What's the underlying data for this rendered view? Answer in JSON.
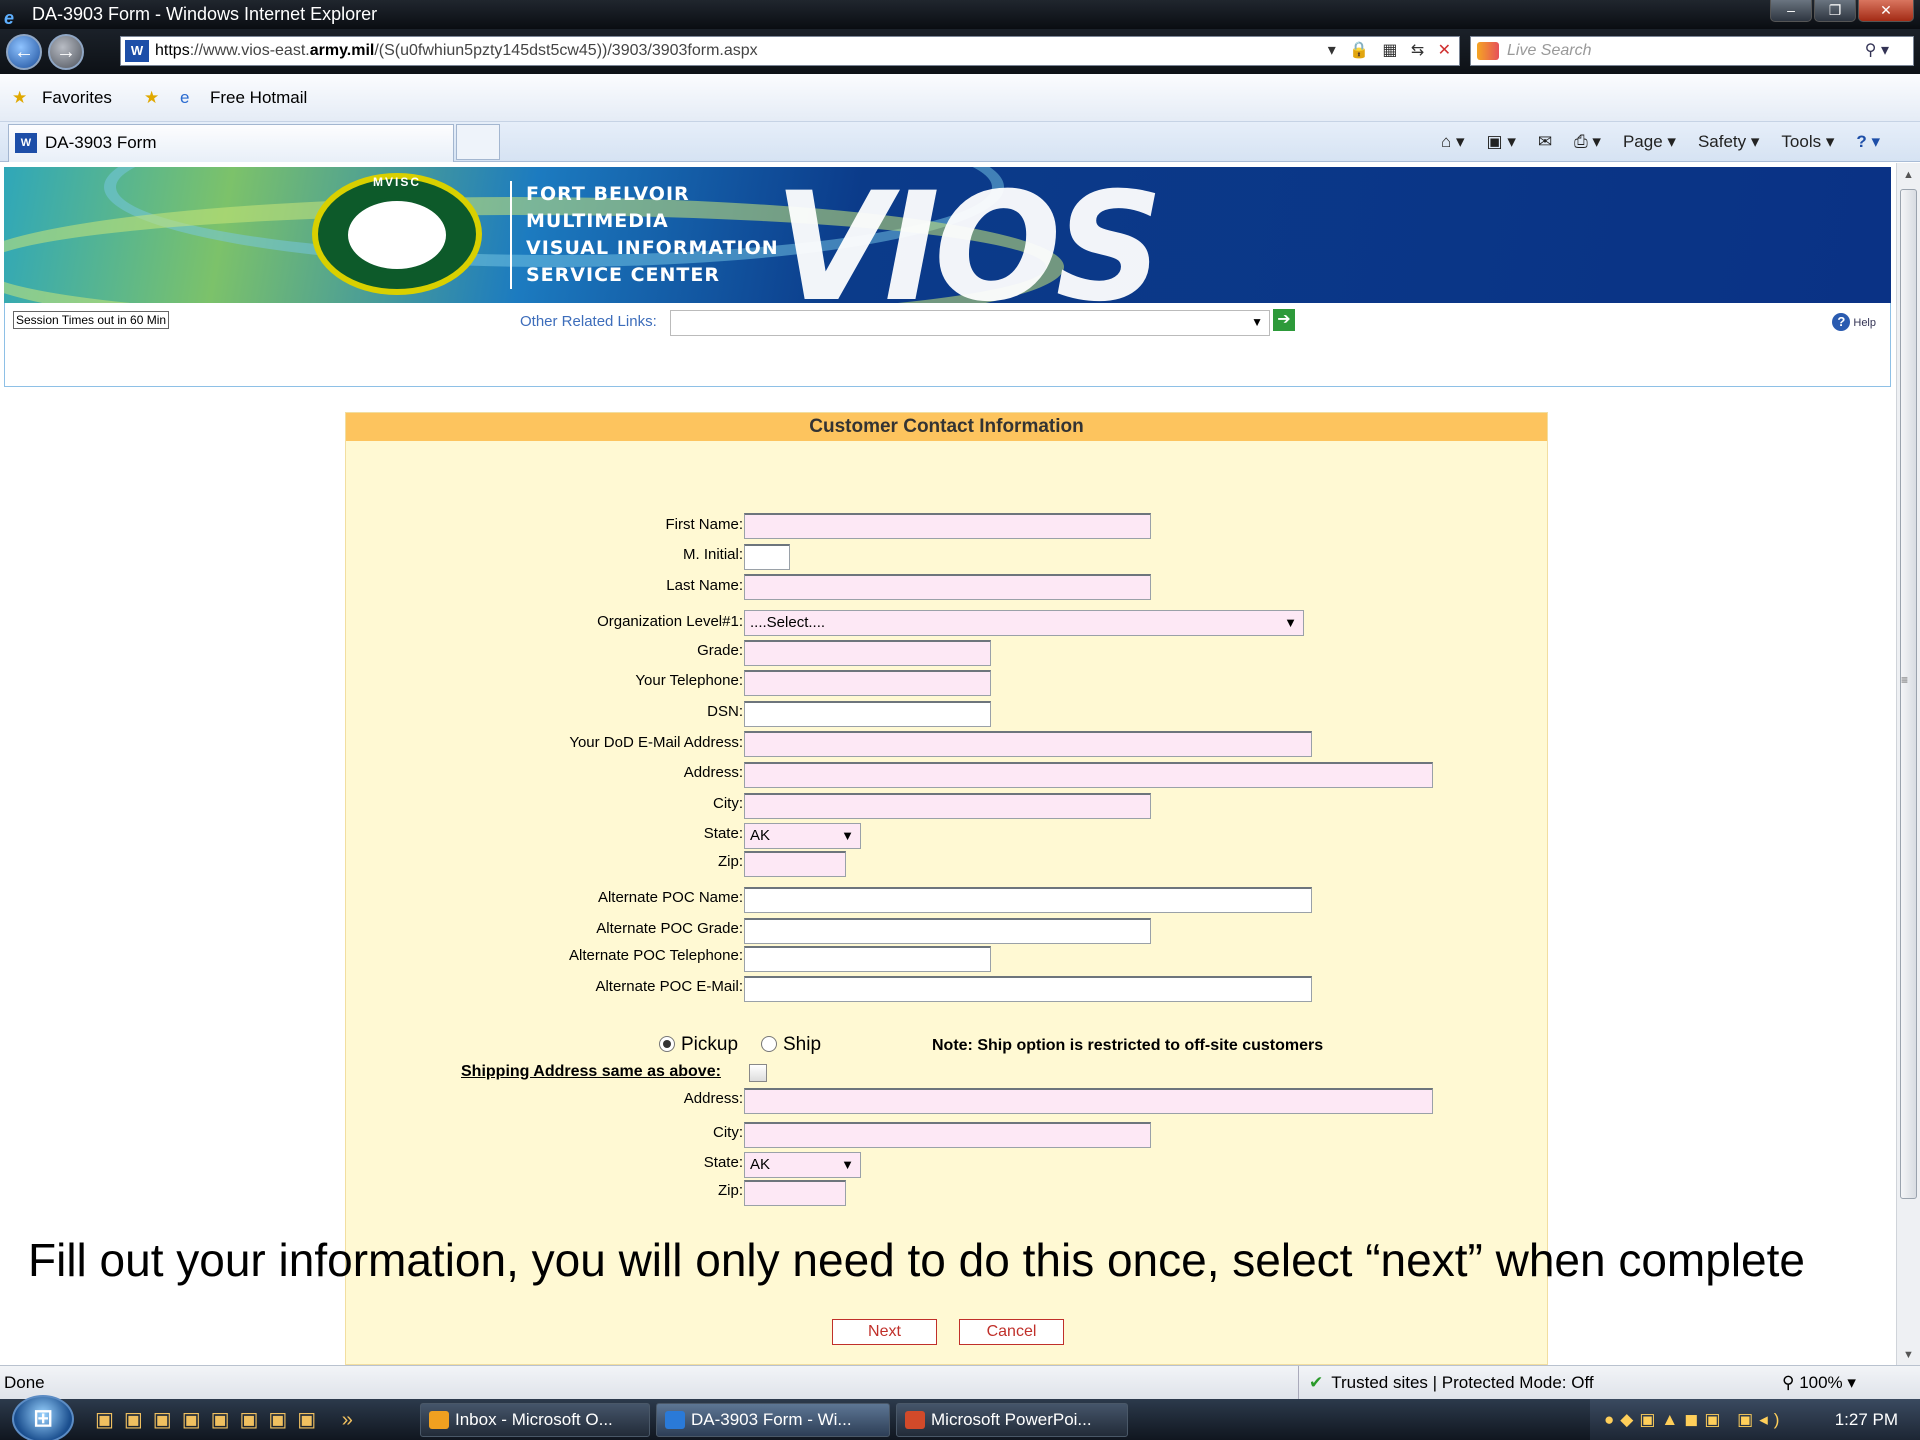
{
  "window": {
    "title": "DA-3903 Form - Windows Internet Explorer"
  },
  "address": {
    "scheme": "https",
    "pre_host": "://www.vios-east.",
    "host": "army.mil",
    "path": "/(S(u0fwhiun5pzty145dst5cw45))/3903/3903form.aspx"
  },
  "search": {
    "placeholder": "Live Search"
  },
  "favbar": {
    "favorites": "Favorites",
    "free_hotmail": "Free Hotmail"
  },
  "tab": {
    "title": "DA-3903 Form"
  },
  "cmdbar": {
    "page": "Page",
    "safety": "Safety",
    "tools": "Tools"
  },
  "banner": {
    "seal_text": "MVISC",
    "lines": [
      "FORT BELVOIR",
      "MULTIMEDIA",
      "VISUAL INFORMATION",
      "SERVICE CENTER"
    ],
    "logo": "VIOS"
  },
  "header": {
    "session": "Session Times out in 60 Min",
    "related_label": "Other Related Links:",
    "help": "Help"
  },
  "form": {
    "title": "Customer Contact Information",
    "labels": {
      "first_name": "First Name:",
      "m_initial": "M. Initial:",
      "last_name": "Last Name:",
      "org_level": "Organization Level#1:",
      "grade": "Grade:",
      "telephone": "Your Telephone:",
      "dsn": "DSN:",
      "email": "Your DoD E-Mail Address:",
      "address": "Address:",
      "city": "City:",
      "state": "State:",
      "zip": "Zip:",
      "alt_name": "Alternate POC Name:",
      "alt_grade": "Alternate POC Grade:",
      "alt_tel": "Alternate POC Telephone:",
      "alt_email": "Alternate POC E-Mail:",
      "ship_address": "Address:",
      "ship_city": "City:",
      "ship_state": "State:",
      "ship_zip": "Zip:"
    },
    "org_level_value": "....Select....",
    "state_value": "AK",
    "ship_state_value": "AK",
    "pickup": "Pickup",
    "ship": "Ship",
    "note": "Note: Ship option is restricted to off-site customers",
    "same_as_above": "Shipping Address same as above:",
    "next": "Next",
    "cancel": "Cancel"
  },
  "caption": "Fill out your information, you will only need to do this once, select “next” when complete",
  "status": {
    "done": "Done",
    "zone": "Trusted sites | Protected Mode: Off",
    "zoom": "100%"
  },
  "taskbar": {
    "items": [
      "Inbox - Microsoft O...",
      "DA-3903 Form - Wi...",
      "Microsoft PowerPoi..."
    ],
    "clock": "1:27 PM"
  }
}
